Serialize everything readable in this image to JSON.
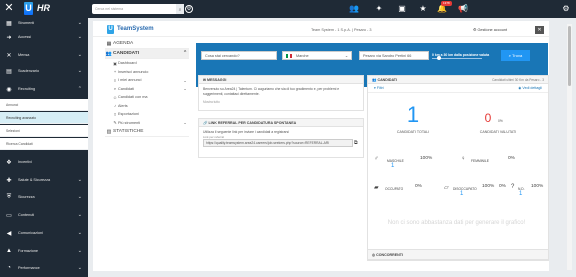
{
  "topbar": {
    "logo": "HR",
    "search_placeholder": "Cerca nel sistema",
    "notifications_count": "1378"
  },
  "sidebar": {
    "items": [
      {
        "label": "Strumenti",
        "icon": "grid-icon"
      },
      {
        "label": "Accessi",
        "icon": "login-icon"
      },
      {
        "label": "Mensa",
        "icon": "cutlery-icon"
      },
      {
        "label": "Scadenzario",
        "icon": "calendar-icon"
      },
      {
        "label": "Recruiting",
        "icon": "recruiting-icon"
      },
      {
        "label": "Incentivi",
        "icon": "incentive-icon"
      },
      {
        "label": "Salute & Sicurezza",
        "icon": "health-icon"
      },
      {
        "label": "Sicurezza",
        "icon": "shield-icon"
      },
      {
        "label": "Contenuti",
        "icon": "content-icon"
      },
      {
        "label": "Comunicazioni",
        "icon": "megaphone-icon"
      },
      {
        "label": "Formazione",
        "icon": "education-icon"
      },
      {
        "label": "Performance",
        "icon": "performance-icon"
      }
    ],
    "sub_items": [
      {
        "label": "Annunci"
      },
      {
        "label": "Recruiting avanzato"
      },
      {
        "label": "Selezioni"
      },
      {
        "label": "Ricerca Candidati"
      }
    ]
  },
  "header": {
    "app_name": "TeamSystem",
    "breadcrumb": "Team System - 1 S.p.A. | Pesaro - 3",
    "account": "Gestione account"
  },
  "leftnav": {
    "agenda": "AGENDA",
    "candidati": "CANDIDATI",
    "items": [
      {
        "label": "Dashboard"
      },
      {
        "label": "Inserisci annuncio"
      },
      {
        "label": "I miei annunci"
      },
      {
        "label": "Candidati"
      },
      {
        "label": "Candidati con ma"
      },
      {
        "label": "Alerts"
      },
      {
        "label": "Esportazioni"
      },
      {
        "label": "Più strumenti"
      }
    ],
    "statistiche": "STATISTICHE"
  },
  "filter": {
    "query_placeholder": "Cosa stai cercando?",
    "region": "Marche",
    "location": "Pesaro via Sandro Pertini 66",
    "distance": "0 km a 30 km dalla posizione valuta",
    "search_label": "Trova"
  },
  "messages": {
    "title": "MESSAGGI",
    "text": "Benvenuto su Area24 | Talentum. Ci auguriamo che sia di tuo gradimento e, per problemi e suggerimenti, contattaci direttamente.",
    "show_all": "Mostra tutto"
  },
  "referral": {
    "title": "LINK REFERRAL PER CANDIDATURA SPONTANEA",
    "text": "Utilizza il seguente link per inviare i candidati a registrarsi",
    "label": "Link per referral",
    "url": "https://quality.teamsystem.area24.careers/job-seekers.php?source=REFERRAL-ARI"
  },
  "stats": {
    "title": "CANDIDATI",
    "period": "Candidati ultimi 30 Km da Pesaro - 3",
    "filter_label": "Filtri",
    "details_label": "Vedi dettagli",
    "total": "1",
    "total_label": "CANDIDATI TOTALI",
    "evaluated": "0",
    "evaluated_pct": "0%",
    "evaluated_label": "CANDIDATI VALUTATI",
    "grid": [
      {
        "label": "MASCHILE",
        "value": "1",
        "pct": "100%"
      },
      {
        "label": "FEMMINILE",
        "value": "",
        "pct": "0%"
      },
      {
        "label": "OCCUPATO",
        "value": "",
        "pct": "0%"
      },
      {
        "label": "DISOCCUPATO",
        "value": "1",
        "pct": "100%"
      },
      {
        "label": "N.D.",
        "value": "1",
        "pct": "100%"
      }
    ],
    "nd_zero": "0%",
    "no_data": "Non ci sono abbastanza dati per generare il grafico!",
    "competitors_title": "CONCORRENTI"
  },
  "colors": {
    "sidebar": "#1f2a36",
    "accent": "#2196f3",
    "filterbar": "#1976b6",
    "danger": "#e53935"
  }
}
